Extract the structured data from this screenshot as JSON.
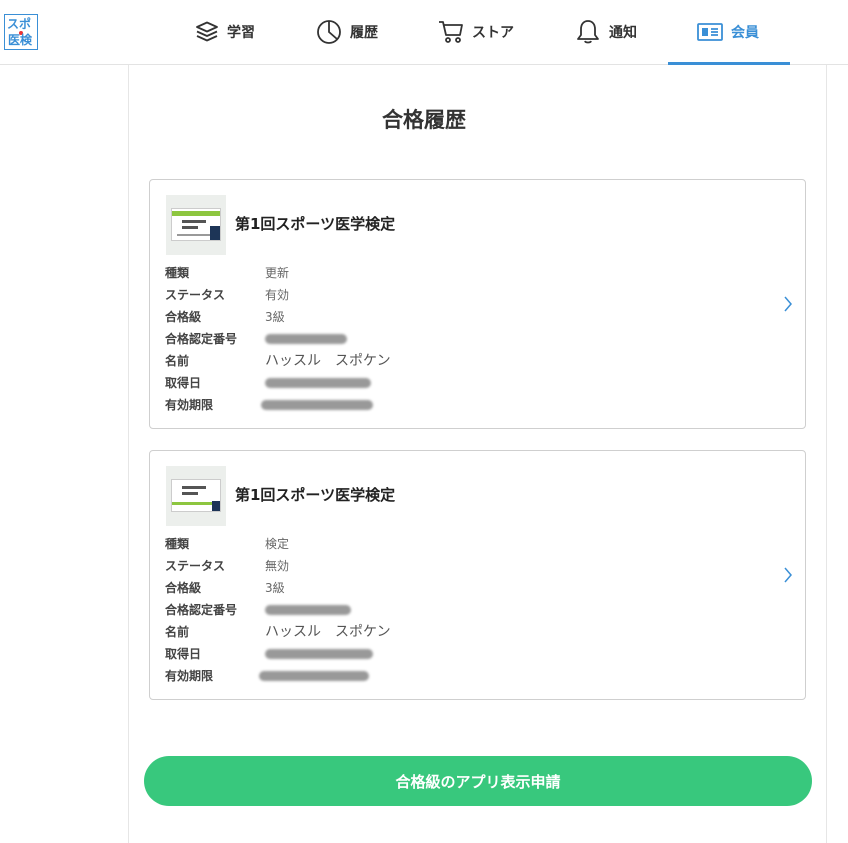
{
  "logo": {
    "line1": "スポ",
    "line2": "医検"
  },
  "nav": [
    {
      "label": "学習",
      "icon": "book-stack-icon"
    },
    {
      "label": "履歴",
      "icon": "clock-icon"
    },
    {
      "label": "ストア",
      "icon": "cart-icon"
    },
    {
      "label": "通知",
      "icon": "bell-icon"
    },
    {
      "label": "会員",
      "icon": "member-card-icon",
      "active": true
    }
  ],
  "page_title": "合格履歴",
  "cards": [
    {
      "title": "第1回スポーツ医学検定",
      "fields": {
        "type_label": "種類",
        "type_value": "更新",
        "status_label": "ステータス",
        "status_value": "有効",
        "grade_label": "合格級",
        "grade_value": "3級",
        "cert_no_label": "合格認定番号",
        "name_label": "名前",
        "name_value": "ハッスル　スポケン",
        "acquired_label": "取得日",
        "expiry_label": "有効期限"
      }
    },
    {
      "title": "第1回スポーツ医学検定",
      "fields": {
        "type_label": "種類",
        "type_value": "検定",
        "status_label": "ステータス",
        "status_value": "無効",
        "grade_label": "合格級",
        "grade_value": "3級",
        "cert_no_label": "合格認定番号",
        "name_label": "名前",
        "name_value": "ハッスル　スポケン",
        "acquired_label": "取得日",
        "expiry_label": "有効期限"
      }
    }
  ],
  "apply_button": "合格級のアプリ表示申請",
  "colors": {
    "accent": "#3a8fd6",
    "button": "#38c87d"
  }
}
